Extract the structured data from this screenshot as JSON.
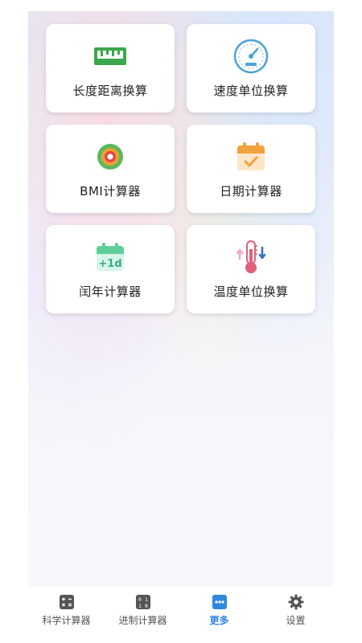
{
  "cards": [
    {
      "label": "长度距离换算",
      "icon": "ruler-icon"
    },
    {
      "label": "速度单位换算",
      "icon": "speedometer-icon"
    },
    {
      "label": "BMI计算器",
      "icon": "target-icon"
    },
    {
      "label": "日期计算器",
      "icon": "calendar-check-icon"
    },
    {
      "label": "闰年计算器",
      "icon": "calendar-plus-one-icon",
      "icon_text": "+1d"
    },
    {
      "label": "温度单位换算",
      "icon": "thermometer-icon"
    }
  ],
  "tabs": [
    {
      "label": "科学计算器",
      "icon": "calculator-icon",
      "active": false
    },
    {
      "label": "进制计算器",
      "icon": "binary-icon",
      "active": false
    },
    {
      "label": "更多",
      "icon": "more-icon",
      "active": true
    },
    {
      "label": "设置",
      "icon": "gear-icon",
      "active": false
    }
  ],
  "colors": {
    "accent": "#2f87e0",
    "tab_inactive": "#555555",
    "ruler": "#3aa84a",
    "calendar": "#f2a23a",
    "leap_calendar": "#5fcf9a",
    "thermometer": "#e0607a"
  }
}
